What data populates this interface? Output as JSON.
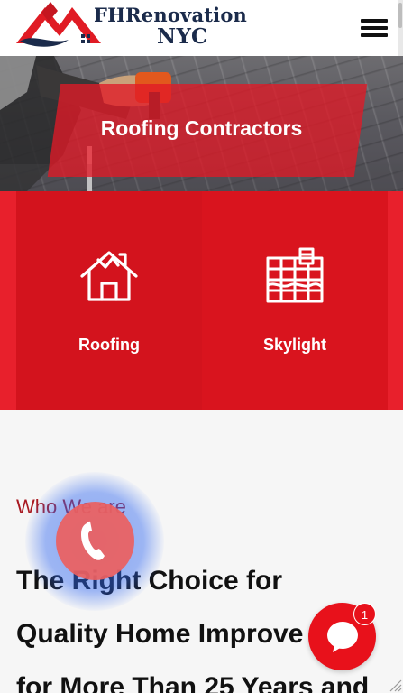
{
  "header": {
    "logo_line1": "FHRenovation",
    "logo_line2": "NYC"
  },
  "hero": {
    "title": "Roofing Contractors"
  },
  "services": [
    {
      "label": "Roofing",
      "icon": "house-roof-icon"
    },
    {
      "label": "Skylight",
      "icon": "skylight-icon"
    }
  ],
  "about": {
    "eyebrow": "Who We are",
    "headline_lines": [
      "The Right Choice for",
      "Quality Home Improve",
      "for More Than 25 Years and"
    ]
  },
  "chat": {
    "badge_count": "1"
  },
  "colors": {
    "brand_red": "#e8202c",
    "card_red": "#d3131d",
    "navy": "#1b2b4b",
    "eyebrow_red": "#a91a22"
  }
}
